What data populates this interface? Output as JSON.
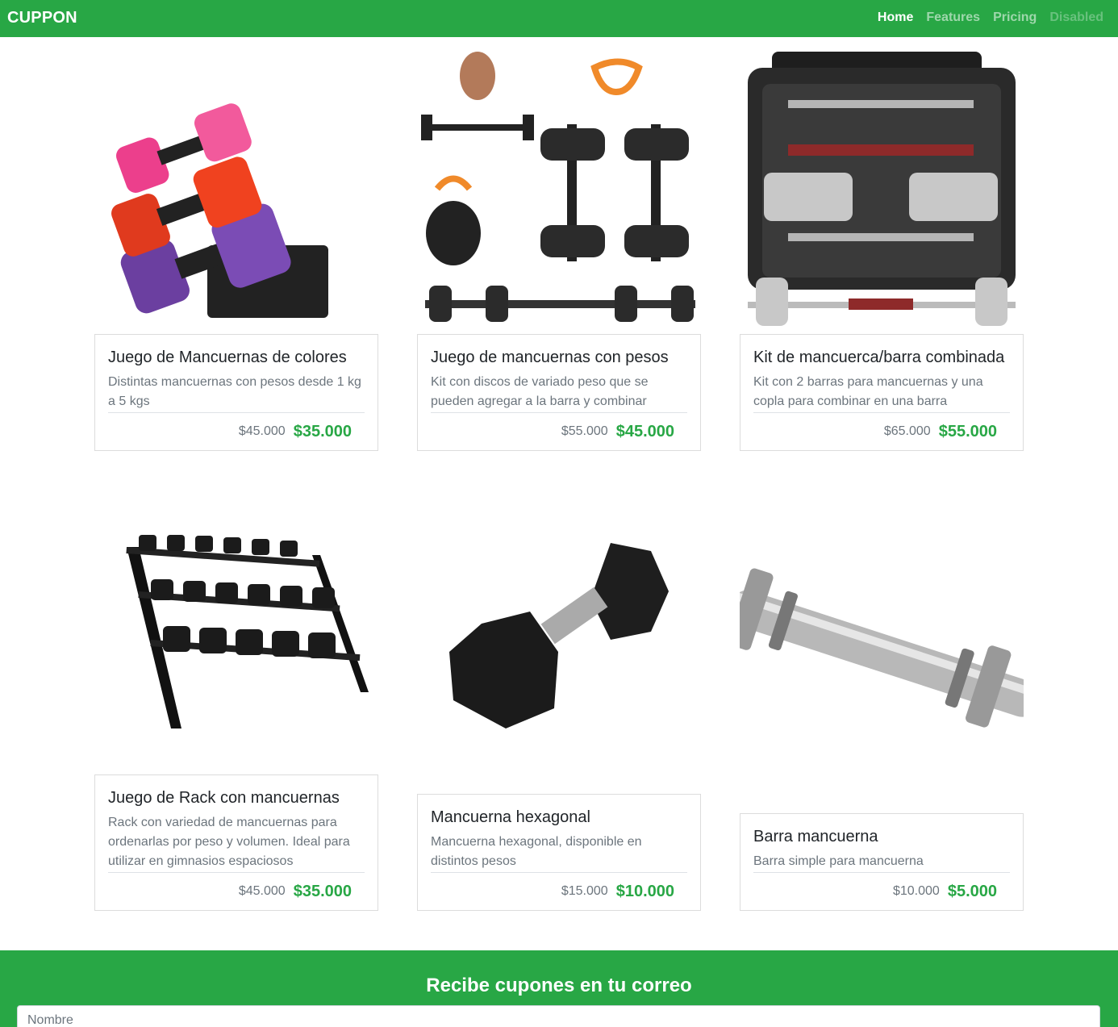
{
  "navbar": {
    "brand": "CUPPON",
    "links": [
      {
        "label": "Home"
      },
      {
        "label": "Features"
      },
      {
        "label": "Pricing"
      },
      {
        "label": "Disabled"
      }
    ],
    "background_color": "#28a745"
  },
  "products": [
    {
      "title": "Juego de Mancuernas de colores",
      "description": "Distintas mancuernas con pesos desde 1 kg a 5 kgs",
      "old_price": "$45.000",
      "new_price": "$35.000",
      "image_icon": "colored-dumbbells-image"
    },
    {
      "title": "Juego de mancuernas con pesos",
      "description": "Kit con discos de variado peso que se pueden agregar a la barra y combinar",
      "old_price": "$55.000",
      "new_price": "$45.000",
      "image_icon": "dumbbell-weights-kit-image"
    },
    {
      "title": "Kit de mancuerca/barra combinada",
      "description": "Kit con 2 barras para mancuernas y una copla para combinar en una barra",
      "old_price": "$65.000",
      "new_price": "$55.000",
      "image_icon": "dumbbell-case-kit-image"
    },
    {
      "title": "Juego de Rack con mancuernas",
      "description": "Rack con variedad de mancuernas para ordenarlas por peso y volumen. Ideal para utilizar en gimnasios espaciosos",
      "old_price": "$45.000",
      "new_price": "$35.000",
      "image_icon": "dumbbell-rack-image"
    },
    {
      "title": "Mancuerna hexagonal",
      "description": "Mancuerna hexagonal, disponible en distintos pesos",
      "old_price": "$15.000",
      "new_price": "$10.000",
      "image_icon": "hex-dumbbell-image"
    },
    {
      "title": "Barra mancuerna",
      "description": "Barra simple para mancuerna",
      "old_price": "$10.000",
      "new_price": "$5.000",
      "image_icon": "dumbbell-bar-image"
    }
  ],
  "newsletter": {
    "title": "Recibe cupones en tu correo",
    "name_placeholder": "Nombre"
  },
  "colors": {
    "accent": "#28a745",
    "old_price": "#6c757d"
  }
}
